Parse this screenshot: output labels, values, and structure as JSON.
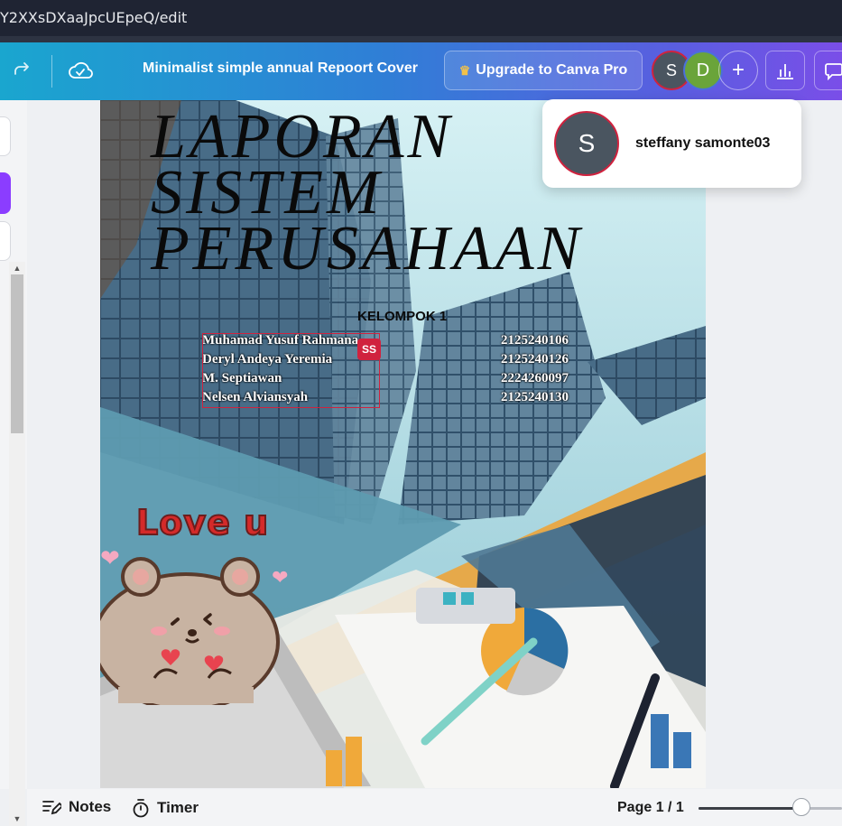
{
  "browser": {
    "url_fragment": "Y2XXsDXaaJpcUEpeQ/edit"
  },
  "toolbar": {
    "document_title": "Minimalist simple annual Repoort Cover",
    "upgrade_label": "Upgrade to Canva Pro",
    "avatars": [
      {
        "initial": "S",
        "color": "#4a5560",
        "border": "#d0223e"
      },
      {
        "initial": "D",
        "color": "#6aa43a"
      }
    ],
    "add_label": "+"
  },
  "canvas": {
    "title_lines": [
      "LAPORAN",
      "SISTEM",
      "PERUSAHAAN"
    ],
    "group_label": "KELOMPOK 1",
    "members": [
      {
        "name": "Muhamad Yusuf Rahmana",
        "id": "2125240106"
      },
      {
        "name": "Deryl Andeya Yeremia",
        "id": "2125240126"
      },
      {
        "name": "M. Septiawan",
        "id": "2224260097"
      },
      {
        "name": "Nelsen Alviansyah",
        "id": "2125240130"
      }
    ],
    "selection_tag": "SS",
    "sticker_text": "Love u",
    "colors": {
      "accent_orange": "#e6a94a",
      "steel_blue": "#5e9bb0",
      "navy": "#2b3f54"
    }
  },
  "collaborator_popover": {
    "initial": "S",
    "name": "steffany samonte03"
  },
  "bottombar": {
    "notes_label": "Notes",
    "timer_label": "Timer",
    "page_indicator": "Page 1 / 1",
    "zoom_level": 0.7
  }
}
